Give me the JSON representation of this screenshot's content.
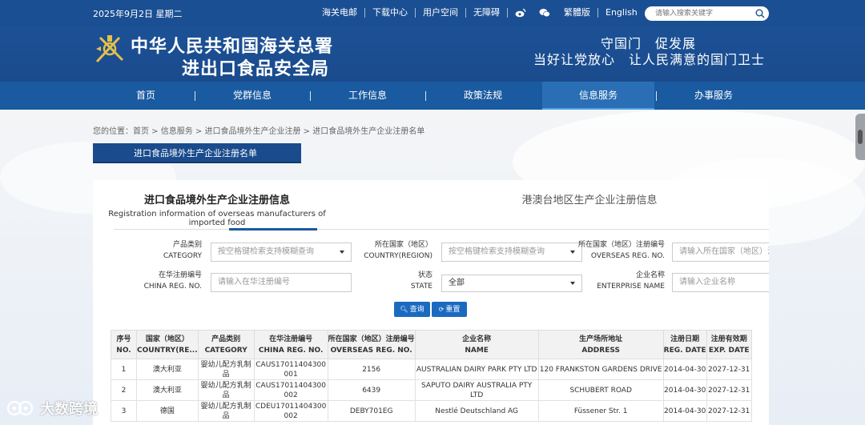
{
  "topbar": {
    "date": "2025年9月2日 星期二",
    "links": [
      "海关电邮",
      "下载中心",
      "用户空间",
      "无障碍"
    ],
    "lang_links": [
      "繁體版",
      "English"
    ],
    "search_placeholder": "请输入搜索关键字"
  },
  "header": {
    "org_line1": "中华人民共和国海关总署",
    "org_line2": "进出口食品安全局",
    "slogan_line1": "守国门　促发展",
    "slogan_line2": "当好让党放心　让人民满意的国门卫士"
  },
  "nav": {
    "items": [
      "首页",
      "党群信息",
      "工作信息",
      "政策法规",
      "信息服务",
      "办事服务"
    ],
    "active_index": 4
  },
  "breadcrumb": "您的位置：首页 > 信息服务 > 进口食品境外生产企业注册 > 进口食品境外生产企业注册名单",
  "page_title": "进口食品境外生产企业注册名单",
  "tabs": {
    "tab1_title": "进口食品境外生产企业注册信息",
    "tab1_subtitle": "Registration information of overseas manufacturers of imported food",
    "tab2_title": "港澳台地区生产企业注册信息"
  },
  "filters": {
    "category_label_cn": "产品类别",
    "category_label_en": "CATEGORY",
    "category_placeholder": "按空格键检索支持模糊查询",
    "country_label_cn": "所在国家（地区）",
    "country_label_en": "COUNTRY(REGION)",
    "country_placeholder": "按空格键检索支持模糊查询",
    "overseas_label_cn": "所在国家（地区）注册编号",
    "overseas_label_en": "OVERSEAS REG. NO.",
    "overseas_placeholder": "请输入所在国家（地区）注",
    "china_label_cn": "在华注册编号",
    "china_label_en": "CHINA REG. NO.",
    "china_placeholder": "请输入在华注册编号",
    "state_label_cn": "状态",
    "state_label_en": "STATE",
    "state_value": "全部",
    "enterprise_label_cn": "企业名称",
    "enterprise_label_en": "ENTERPRISE NAME",
    "enterprise_placeholder": "请输入企业名称"
  },
  "buttons": {
    "query": "查询",
    "reset": "重置"
  },
  "table": {
    "headers_cn": [
      "序号",
      "国家（地区）",
      "产品类别",
      "在华注册编号",
      "所在国家（地区）注册编号",
      "企业名称",
      "生产场所地址",
      "注册日期",
      "注册有效期"
    ],
    "headers_en": [
      "NO.",
      "COUNTRY(RE...",
      "CATEGORY",
      "CHINA REG. NO.",
      "OVERSEAS REG. NO.",
      "NAME",
      "ADDRESS",
      "REG. DATE",
      "EXP. DATE"
    ],
    "rows": [
      {
        "no": "1",
        "country": "澳大利亚",
        "category": "婴幼儿配方乳制品",
        "china_reg": "CAUS17011404300001",
        "overseas_reg": "2156",
        "name": "AUSTRALIAN DAIRY PARK PTY LTD",
        "address": "120 FRANKSTON GARDENS DRIVE",
        "reg_date": "2014-04-30",
        "exp_date": "2027-12-31"
      },
      {
        "no": "2",
        "country": "澳大利亚",
        "category": "婴幼儿配方乳制品",
        "china_reg": "CAUS17011404300002",
        "overseas_reg": "6439",
        "name": "SAPUTO DAIRY AUSTRALIA PTY LTD",
        "address": "SCHUBERT ROAD",
        "reg_date": "2014-04-30",
        "exp_date": "2027-12-31"
      },
      {
        "no": "3",
        "country": "德国",
        "category": "婴幼儿配方乳制品",
        "china_reg": "CDEU17011404300002",
        "overseas_reg": "DEBY701EG",
        "name": "Nestlé Deutschland AG",
        "address": "Füssener Str. 1",
        "reg_date": "2014-04-30",
        "exp_date": "2027-12-31"
      }
    ]
  },
  "watermark": "大数跨境"
}
